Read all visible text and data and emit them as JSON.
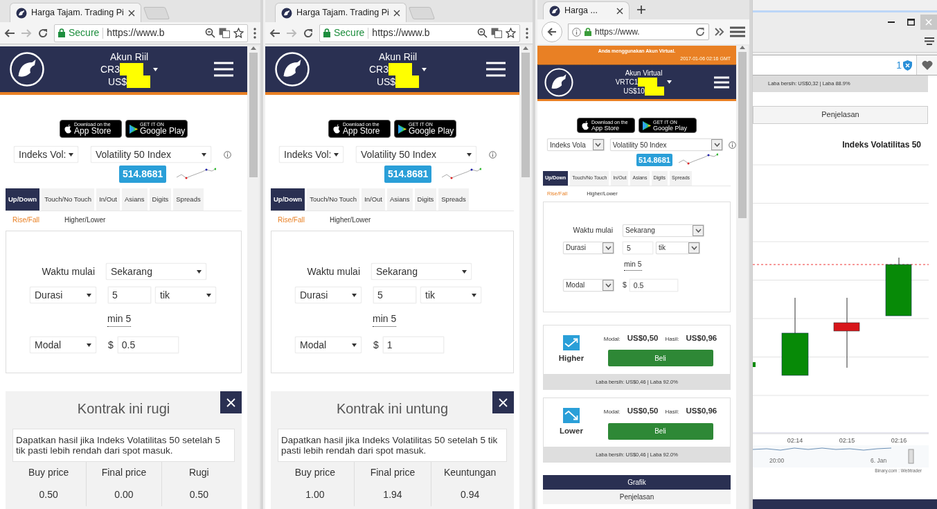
{
  "windows": [
    {
      "kind": "chrome",
      "tab_title": "Harga Tajam. Trading Pi",
      "secure_label": "Secure",
      "url": "https://www.b",
      "header": {
        "account_type": "Akun Riil",
        "account_id": "CR3",
        "balance": "US$",
        "redacted": true
      },
      "store_badges": [
        {
          "kind": "apple",
          "small": "Download on the",
          "big": "App Store"
        },
        {
          "kind": "google",
          "small": "GET IT ON",
          "big": "Google Play"
        }
      ],
      "market": "Indeks Vol:",
      "underlying": "Volatility 50 Index",
      "spot": "514.8681",
      "tabs": [
        {
          "label": "Up/Down",
          "selected": true
        },
        {
          "label": "Touch/No Touch",
          "selected": false
        },
        {
          "label": "In/Out",
          "selected": false
        },
        {
          "label": "Asians",
          "selected": false
        },
        {
          "label": "Digits",
          "selected": false
        },
        {
          "label": "Spreads",
          "selected": false
        }
      ],
      "subtabs": [
        {
          "label": "Rise/Fall",
          "selected": true
        },
        {
          "label": "Higher/Lower",
          "selected": false
        }
      ],
      "form": {
        "start_label": "Waktu mulai",
        "start_value": "Sekarang",
        "duration_label": "Durasi",
        "duration_value": "5",
        "duration_unit": "tik",
        "min_note": "min 5",
        "amount_label": "Modal",
        "currency": "$",
        "amount_value": "0.5"
      },
      "result": {
        "title": "Kontrak ini rugi",
        "description": "Dapatkan hasil jika Indeks Volatilitas 50 setelah 5 tik pasti lebih rendah dari spot masuk.",
        "columns": [
          "Buy price",
          "Final price",
          "Rugi"
        ],
        "values": [
          "0.50",
          "0.00",
          "0.50"
        ]
      }
    },
    {
      "kind": "chrome",
      "tab_title": "Harga Tajam. Trading Pi",
      "secure_label": "Secure",
      "url": "https://www.b",
      "header": {
        "account_type": "Akun Riil",
        "account_id": "CR3",
        "balance": "US$",
        "redacted": true
      },
      "store_badges": [
        {
          "kind": "apple",
          "small": "Download on the",
          "big": "App Store"
        },
        {
          "kind": "google",
          "small": "GET IT ON",
          "big": "Google Play"
        }
      ],
      "market": "Indeks Vol:",
      "underlying": "Volatility 50 Index",
      "spot": "514.8681",
      "tabs": [
        {
          "label": "Up/Down",
          "selected": true
        },
        {
          "label": "Touch/No Touch",
          "selected": false
        },
        {
          "label": "In/Out",
          "selected": false
        },
        {
          "label": "Asians",
          "selected": false
        },
        {
          "label": "Digits",
          "selected": false
        },
        {
          "label": "Spreads",
          "selected": false
        }
      ],
      "subtabs": [
        {
          "label": "Rise/Fall",
          "selected": true
        },
        {
          "label": "Higher/Lower",
          "selected": false
        }
      ],
      "form": {
        "start_label": "Waktu mulai",
        "start_value": "Sekarang",
        "duration_label": "Durasi",
        "duration_value": "5",
        "duration_unit": "tik",
        "min_note": "min 5",
        "amount_label": "Modal",
        "currency": "$",
        "amount_value": "1"
      },
      "result": {
        "title": "Kontrak ini untung",
        "description": "Dapatkan hasil jika Indeks Volatilitas 50 setelah 5 tik pasti lebih rendah dari spot masuk.",
        "columns": [
          "Buy price",
          "Final price",
          "Keuntungan"
        ],
        "values": [
          "1.00",
          "1.94",
          "0.94"
        ]
      }
    },
    {
      "kind": "firefox",
      "tab_title": "Harga ...",
      "url": "https://www.",
      "banner": {
        "message": "Anda menggunakan Akun Virtual.",
        "time": "2017-01-06 02:16 GMT"
      },
      "header": {
        "account_type": "Akun Virtual",
        "account_id": "VRTC1",
        "balance": "US$10",
        "redacted": true
      },
      "store_badges": [
        {
          "kind": "apple",
          "small": "Download on the",
          "big": "App Store"
        },
        {
          "kind": "google",
          "small": "GET IT ON",
          "big": "Google Play"
        }
      ],
      "market": "Indeks Vola",
      "underlying": "Volatility 50 Index",
      "spot": "514.8681",
      "tabs": [
        {
          "label": "Up/Down",
          "selected": true
        },
        {
          "label": "Touch/No Touch",
          "selected": false
        },
        {
          "label": "In/Out",
          "selected": false
        },
        {
          "label": "Asians",
          "selected": false
        },
        {
          "label": "Digits",
          "selected": false
        },
        {
          "label": "Spreads",
          "selected": false
        }
      ],
      "subtabs": [
        {
          "label": "Rise/Fall",
          "selected": true
        },
        {
          "label": "Higher/Lower",
          "selected": false
        }
      ],
      "form": {
        "start_label": "Waktu mulai",
        "start_value": "Sekarang",
        "duration_label": "Durasi",
        "duration_value": "5",
        "duration_unit": "tik",
        "min_note": "min 5",
        "amount_label": "Modal",
        "currency": "$",
        "amount_value": "0.5"
      },
      "contracts": [
        {
          "kind": "higher",
          "name": "Higher",
          "stake_label": "Modal:",
          "stake": "US$0,50",
          "payout_label": "Hasil:",
          "payout": "US$0,96",
          "button": "Beli",
          "footer": "Laba bersih: US$0,46 | Laba 92.0%"
        },
        {
          "kind": "lower",
          "name": "Lower",
          "stake_label": "Modal:",
          "stake": "US$0,50",
          "payout_label": "Hasil:",
          "payout": "US$0,96",
          "button": "Beli",
          "footer": "Laba bersih: US$0,46 | Laba 92.0%"
        }
      ],
      "bottom_tabs": [
        {
          "label": "Grafik",
          "selected": true
        },
        {
          "label": "Penjelasan",
          "selected": false
        }
      ]
    }
  ],
  "side_window": {
    "notification_count": "1",
    "footer_text": "Laba bersih: US$0,32 | Laba 88.9%",
    "tab": "Penjelasan",
    "chart_title": "Indeks Volatilitas 50",
    "x_labels": [
      "02:14",
      "02:15",
      "02:16"
    ],
    "navigator_labels": [
      "20:00",
      "6. Jan"
    ],
    "credit": "Binary.com : Webtrader"
  }
}
